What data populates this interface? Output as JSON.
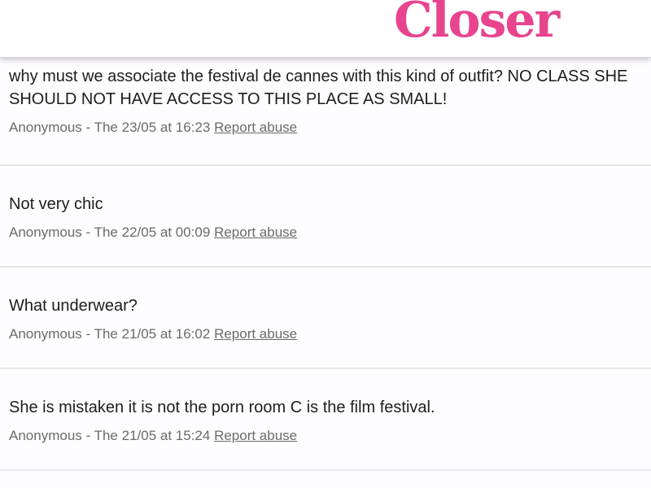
{
  "header": {
    "logo": "Closer"
  },
  "comments": [
    {
      "text": "why must we associate the festival de cannes with this kind of outfit? NO CLASS SHE SHOULD NOT HAVE ACCESS TO THIS PLACE AS SMALL!",
      "author": "Anonymous",
      "date": "The 23/05 at 16:23",
      "report_label": "Report abuse"
    },
    {
      "text": "Not very chic",
      "author": "Anonymous",
      "date": "The 22/05 at 00:09",
      "report_label": "Report abuse"
    },
    {
      "text": "What underwear?",
      "author": "Anonymous",
      "date": "The 21/05 at 16:02",
      "report_label": "Report abuse"
    },
    {
      "text": "She is mistaken it is not the porn room C is the film festival.",
      "author": "Anonymous",
      "date": "The 21/05 at 15:24",
      "report_label": "Report abuse"
    }
  ],
  "colors": {
    "brand": "#e8448e",
    "text": "#1e1e1e",
    "meta": "#6b6b6b",
    "divider": "#e9e5ec"
  }
}
